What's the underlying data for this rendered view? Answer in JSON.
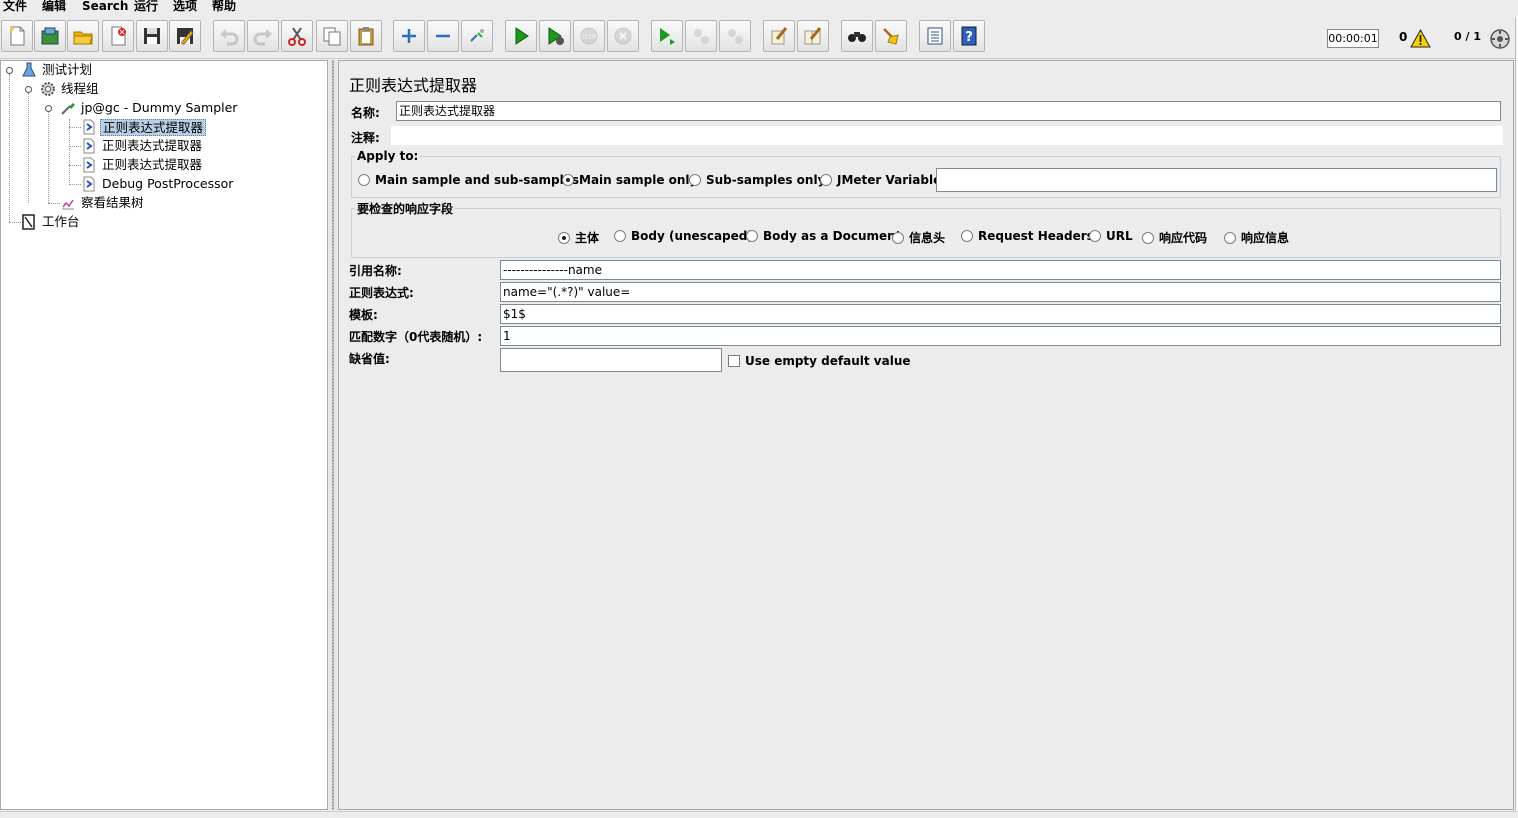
{
  "menubar": {
    "items": [
      "文件",
      "编辑",
      "Search",
      "运行",
      "选项",
      "帮助"
    ]
  },
  "toolbar": {
    "timer": "00:00:01",
    "error_count": "0",
    "thread_count": "0 / 1"
  },
  "tree": {
    "test_plan": "测试计划",
    "thread_group": "线程组",
    "sampler": "jp@gc - Dummy Sampler",
    "extractor_1": "正则表达式提取器",
    "extractor_2": "正则表达式提取器",
    "extractor_3": "正则表达式提取器",
    "debug_post": "Debug PostProcessor",
    "results_tree": "察看结果树",
    "workbench": "工作台"
  },
  "form": {
    "title": "正则表达式提取器",
    "name_label": "名称:",
    "name_value": "正则表达式提取器",
    "comment_label": "注释:",
    "apply_to": {
      "title": "Apply to:",
      "options": [
        "Main sample and sub-samples",
        "Main sample only",
        "Sub-samples only",
        "JMeter Variable"
      ],
      "selected": "Main sample only",
      "variable_value": ""
    },
    "response_field": {
      "title": "要检查的响应字段",
      "options": [
        "主体",
        "Body (unescaped)",
        "Body as a Document",
        "信息头",
        "Request Headers",
        "URL",
        "响应代码",
        "响应信息"
      ],
      "selected": "主体"
    },
    "ref_name_label": "引用名称:",
    "ref_name_value": "---------------name",
    "regex_label": "正则表达式:",
    "regex_value": "name=\"(.*?)\" value=",
    "template_label": "模板:",
    "template_value": "$1$",
    "match_no_label": "匹配数字（0代表随机）:",
    "match_no_value": "1",
    "default_label": "缺省值:",
    "default_value": "",
    "use_empty_label": "Use empty default value"
  }
}
